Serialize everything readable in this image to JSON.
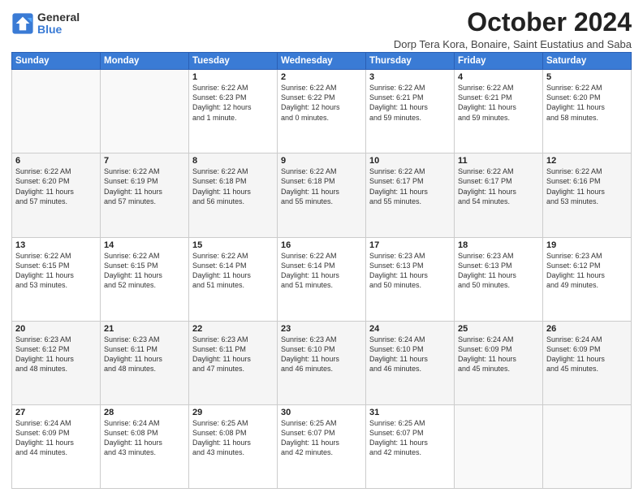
{
  "logo": {
    "general": "General",
    "blue": "Blue"
  },
  "title": "October 2024",
  "subtitle": "Dorp Tera Kora, Bonaire, Saint Eustatius and Saba",
  "headers": [
    "Sunday",
    "Monday",
    "Tuesday",
    "Wednesday",
    "Thursday",
    "Friday",
    "Saturday"
  ],
  "weeks": [
    [
      {
        "day": "",
        "info": ""
      },
      {
        "day": "",
        "info": ""
      },
      {
        "day": "1",
        "info": "Sunrise: 6:22 AM\nSunset: 6:23 PM\nDaylight: 12 hours\nand 1 minute."
      },
      {
        "day": "2",
        "info": "Sunrise: 6:22 AM\nSunset: 6:22 PM\nDaylight: 12 hours\nand 0 minutes."
      },
      {
        "day": "3",
        "info": "Sunrise: 6:22 AM\nSunset: 6:21 PM\nDaylight: 11 hours\nand 59 minutes."
      },
      {
        "day": "4",
        "info": "Sunrise: 6:22 AM\nSunset: 6:21 PM\nDaylight: 11 hours\nand 59 minutes."
      },
      {
        "day": "5",
        "info": "Sunrise: 6:22 AM\nSunset: 6:20 PM\nDaylight: 11 hours\nand 58 minutes."
      }
    ],
    [
      {
        "day": "6",
        "info": "Sunrise: 6:22 AM\nSunset: 6:20 PM\nDaylight: 11 hours\nand 57 minutes."
      },
      {
        "day": "7",
        "info": "Sunrise: 6:22 AM\nSunset: 6:19 PM\nDaylight: 11 hours\nand 57 minutes."
      },
      {
        "day": "8",
        "info": "Sunrise: 6:22 AM\nSunset: 6:18 PM\nDaylight: 11 hours\nand 56 minutes."
      },
      {
        "day": "9",
        "info": "Sunrise: 6:22 AM\nSunset: 6:18 PM\nDaylight: 11 hours\nand 55 minutes."
      },
      {
        "day": "10",
        "info": "Sunrise: 6:22 AM\nSunset: 6:17 PM\nDaylight: 11 hours\nand 55 minutes."
      },
      {
        "day": "11",
        "info": "Sunrise: 6:22 AM\nSunset: 6:17 PM\nDaylight: 11 hours\nand 54 minutes."
      },
      {
        "day": "12",
        "info": "Sunrise: 6:22 AM\nSunset: 6:16 PM\nDaylight: 11 hours\nand 53 minutes."
      }
    ],
    [
      {
        "day": "13",
        "info": "Sunrise: 6:22 AM\nSunset: 6:15 PM\nDaylight: 11 hours\nand 53 minutes."
      },
      {
        "day": "14",
        "info": "Sunrise: 6:22 AM\nSunset: 6:15 PM\nDaylight: 11 hours\nand 52 minutes."
      },
      {
        "day": "15",
        "info": "Sunrise: 6:22 AM\nSunset: 6:14 PM\nDaylight: 11 hours\nand 51 minutes."
      },
      {
        "day": "16",
        "info": "Sunrise: 6:22 AM\nSunset: 6:14 PM\nDaylight: 11 hours\nand 51 minutes."
      },
      {
        "day": "17",
        "info": "Sunrise: 6:23 AM\nSunset: 6:13 PM\nDaylight: 11 hours\nand 50 minutes."
      },
      {
        "day": "18",
        "info": "Sunrise: 6:23 AM\nSunset: 6:13 PM\nDaylight: 11 hours\nand 50 minutes."
      },
      {
        "day": "19",
        "info": "Sunrise: 6:23 AM\nSunset: 6:12 PM\nDaylight: 11 hours\nand 49 minutes."
      }
    ],
    [
      {
        "day": "20",
        "info": "Sunrise: 6:23 AM\nSunset: 6:12 PM\nDaylight: 11 hours\nand 48 minutes."
      },
      {
        "day": "21",
        "info": "Sunrise: 6:23 AM\nSunset: 6:11 PM\nDaylight: 11 hours\nand 48 minutes."
      },
      {
        "day": "22",
        "info": "Sunrise: 6:23 AM\nSunset: 6:11 PM\nDaylight: 11 hours\nand 47 minutes."
      },
      {
        "day": "23",
        "info": "Sunrise: 6:23 AM\nSunset: 6:10 PM\nDaylight: 11 hours\nand 46 minutes."
      },
      {
        "day": "24",
        "info": "Sunrise: 6:24 AM\nSunset: 6:10 PM\nDaylight: 11 hours\nand 46 minutes."
      },
      {
        "day": "25",
        "info": "Sunrise: 6:24 AM\nSunset: 6:09 PM\nDaylight: 11 hours\nand 45 minutes."
      },
      {
        "day": "26",
        "info": "Sunrise: 6:24 AM\nSunset: 6:09 PM\nDaylight: 11 hours\nand 45 minutes."
      }
    ],
    [
      {
        "day": "27",
        "info": "Sunrise: 6:24 AM\nSunset: 6:09 PM\nDaylight: 11 hours\nand 44 minutes."
      },
      {
        "day": "28",
        "info": "Sunrise: 6:24 AM\nSunset: 6:08 PM\nDaylight: 11 hours\nand 43 minutes."
      },
      {
        "day": "29",
        "info": "Sunrise: 6:25 AM\nSunset: 6:08 PM\nDaylight: 11 hours\nand 43 minutes."
      },
      {
        "day": "30",
        "info": "Sunrise: 6:25 AM\nSunset: 6:07 PM\nDaylight: 11 hours\nand 42 minutes."
      },
      {
        "day": "31",
        "info": "Sunrise: 6:25 AM\nSunset: 6:07 PM\nDaylight: 11 hours\nand 42 minutes."
      },
      {
        "day": "",
        "info": ""
      },
      {
        "day": "",
        "info": ""
      }
    ]
  ]
}
